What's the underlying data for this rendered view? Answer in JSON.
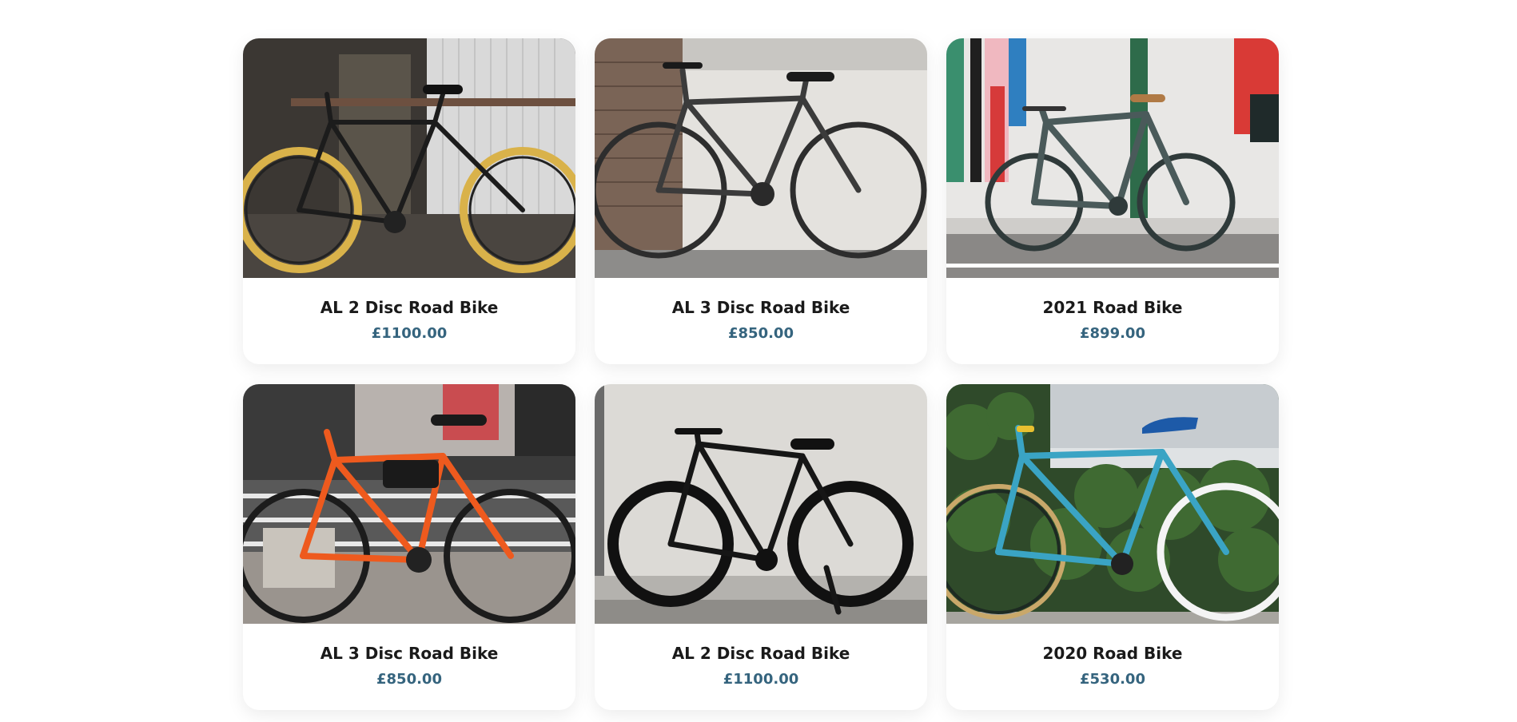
{
  "products": [
    {
      "title": "AL 2 Disc Road Bike",
      "price": "£1100.00",
      "photo": "black-bike-yellow-wheels-icon"
    },
    {
      "title": "AL 3 Disc Road Bike",
      "price": "£850.00",
      "photo": "grey-road-bike-icon"
    },
    {
      "title": "2021 Road Bike",
      "price": "£899.00",
      "photo": "slate-road-bike-icon"
    },
    {
      "title": "AL 3 Disc Road Bike",
      "price": "£850.00",
      "photo": "orange-road-bike-icon"
    },
    {
      "title": "AL 2 Disc Road Bike",
      "price": "£1100.00",
      "photo": "black-road-bike-icon"
    },
    {
      "title": "2020 Road Bike",
      "price": "£530.00",
      "photo": "teal-road-bike-icon"
    }
  ],
  "colors": {
    "price": "#35647e",
    "title": "#1a1a1a"
  }
}
